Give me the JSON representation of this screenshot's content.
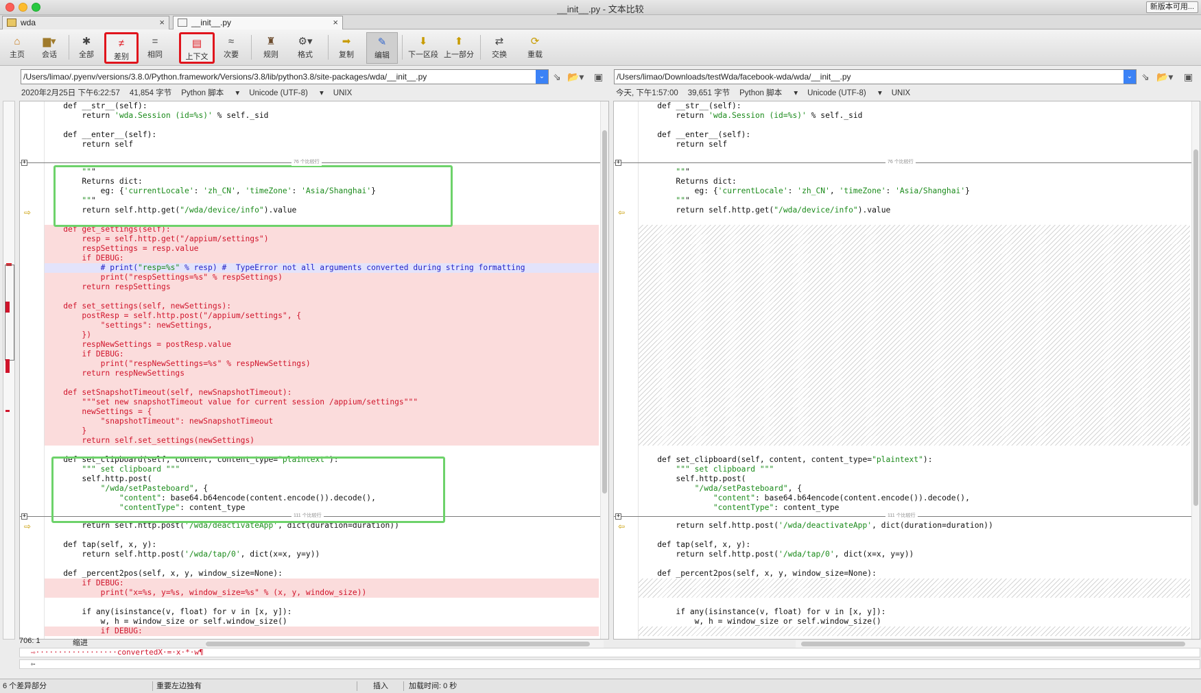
{
  "window": {
    "title": "__init__.py - 文本比较",
    "update_button": "新版本可用..."
  },
  "tabs": [
    {
      "label": "wda"
    },
    {
      "label": "__init__.py"
    }
  ],
  "toolbar": {
    "home": "主页",
    "session": "会话",
    "all": "全部",
    "diff": "差别",
    "same": "相同",
    "context": "上下文",
    "minor": "次要",
    "rules": "规则",
    "format": "格式",
    "copy": "复制",
    "edit": "编辑",
    "next_section": "下一区段",
    "prev_part": "上一部分",
    "swap": "交换",
    "reload": "重载"
  },
  "left": {
    "path": "/Users/limao/.pyenv/versions/3.8.0/Python.framework/Versions/3.8/lib/python3.8/site-packages/wda/__init__.py",
    "date": "2020年2月25日 下午6:22:57",
    "size": "41,854 字节",
    "lang": "Python 脚本",
    "encoding": "Unicode (UTF-8)",
    "eol": "UNIX"
  },
  "right": {
    "path": "/Users/limao/Downloads/testWda/facebook-wda/wda/__init__.py",
    "date": "今天, 下午1:57:00",
    "size": "39,651 字节",
    "lang": "Python 脚本",
    "encoding": "Unicode (UTF-8)",
    "eol": "UNIX"
  },
  "fold_labels": [
    "76 个比较行",
    "111 个比较行"
  ],
  "lines": [
    {
      "t": "s",
      "l": "    def __str__(self):",
      "r": "    def __str__(self):"
    },
    {
      "t": "s",
      "l": "        return 'wda.Session (id=%s)' % self._sid",
      "r": "        return 'wda.Session (id=%s)' % self._sid"
    },
    {
      "t": "s",
      "l": "",
      "r": ""
    },
    {
      "t": "s",
      "l": "    def __enter__(self):",
      "r": "    def __enter__(self):"
    },
    {
      "t": "s",
      "l": "        return self",
      "r": "        return self"
    },
    {
      "t": "s",
      "l": "",
      "r": ""
    },
    {
      "t": "fold",
      "f": 0
    },
    {
      "t": "s",
      "l": "        \"\"\"",
      "r": "        \"\"\""
    },
    {
      "t": "s",
      "l": "        Returns dict:",
      "r": "        Returns dict:"
    },
    {
      "t": "s",
      "l": "            eg: {'currentLocale': 'zh_CN', 'timeZone': 'Asia/Shanghai'}",
      "r": "            eg: {'currentLocale': 'zh_CN', 'timeZone': 'Asia/Shanghai'}"
    },
    {
      "t": "s",
      "l": "        \"\"\"",
      "r": "        \"\"\""
    },
    {
      "t": "s",
      "l": "        return self.http.get(\"/wda/device/info\").value",
      "r": "        return self.http.get(\"/wda/device/info\").value"
    },
    {
      "t": "s",
      "l": "",
      "r": ""
    },
    {
      "t": "d",
      "l": "    def get_settings(self):",
      "r": ""
    },
    {
      "t": "d",
      "l": "        resp = self.http.get(\"/appium/settings\")",
      "r": ""
    },
    {
      "t": "d",
      "l": "        respSettings = resp.value",
      "r": ""
    },
    {
      "t": "d",
      "l": "        if DEBUG:",
      "r": ""
    },
    {
      "t": "b",
      "l": "            # print(\"resp=%s\" % resp) #  TypeError not all arguments converted during string formatting",
      "r": ""
    },
    {
      "t": "d",
      "l": "            print(\"respSettings=%s\" % respSettings)",
      "r": ""
    },
    {
      "t": "d",
      "l": "        return respSettings",
      "r": ""
    },
    {
      "t": "d",
      "l": "",
      "r": ""
    },
    {
      "t": "d",
      "l": "    def set_settings(self, newSettings):",
      "r": ""
    },
    {
      "t": "d",
      "l": "        postResp = self.http.post(\"/appium/settings\", {",
      "r": ""
    },
    {
      "t": "d",
      "l": "            \"settings\": newSettings,",
      "r": ""
    },
    {
      "t": "d",
      "l": "        })",
      "r": ""
    },
    {
      "t": "d",
      "l": "        respNewSettings = postResp.value",
      "r": ""
    },
    {
      "t": "d",
      "l": "        if DEBUG:",
      "r": ""
    },
    {
      "t": "d",
      "l": "            print(\"respNewSettings=%s\" % respNewSettings)",
      "r": ""
    },
    {
      "t": "d",
      "l": "        return respNewSettings",
      "r": ""
    },
    {
      "t": "d",
      "l": "",
      "r": ""
    },
    {
      "t": "d",
      "l": "    def setSnapshotTimeout(self, newSnapshotTimeout):",
      "r": ""
    },
    {
      "t": "d",
      "l": "        \"\"\"set new snapshotTimeout value for current session /appium/settings\"\"\"",
      "r": ""
    },
    {
      "t": "d",
      "l": "        newSettings = {",
      "r": ""
    },
    {
      "t": "d",
      "l": "            \"snapshotTimeout\": newSnapshotTimeout",
      "r": ""
    },
    {
      "t": "d",
      "l": "        }",
      "r": ""
    },
    {
      "t": "d",
      "l": "        return self.set_settings(newSettings)",
      "r": ""
    },
    {
      "t": "s",
      "l": "",
      "r": ""
    },
    {
      "t": "s",
      "l": "    def set_clipboard(self, content, content_type=\"plaintext\"):",
      "r": "    def set_clipboard(self, content, content_type=\"plaintext\"):"
    },
    {
      "t": "s",
      "l": "        \"\"\" set clipboard \"\"\"",
      "r": "        \"\"\" set clipboard \"\"\""
    },
    {
      "t": "s",
      "l": "        self.http.post(",
      "r": "        self.http.post("
    },
    {
      "t": "s",
      "l": "            \"/wda/setPasteboard\", {",
      "r": "            \"/wda/setPasteboard\", {"
    },
    {
      "t": "s",
      "l": "                \"content\": base64.b64encode(content.encode()).decode(),",
      "r": "                \"content\": base64.b64encode(content.encode()).decode(),"
    },
    {
      "t": "s",
      "l": "                \"contentType\": content_type",
      "r": "                \"contentType\": content_type"
    },
    {
      "t": "fold",
      "f": 1
    },
    {
      "t": "s",
      "l": "        return self.http.post('/wda/deactivateApp', dict(duration=duration))",
      "r": "        return self.http.post('/wda/deactivateApp', dict(duration=duration))"
    },
    {
      "t": "s",
      "l": "",
      "r": ""
    },
    {
      "t": "s",
      "l": "    def tap(self, x, y):",
      "r": "    def tap(self, x, y):"
    },
    {
      "t": "s",
      "l": "        return self.http.post('/wda/tap/0', dict(x=x, y=y))",
      "r": "        return self.http.post('/wda/tap/0', dict(x=x, y=y))"
    },
    {
      "t": "s",
      "l": "",
      "r": ""
    },
    {
      "t": "s",
      "l": "    def _percent2pos(self, x, y, window_size=None):",
      "r": "    def _percent2pos(self, x, y, window_size=None):"
    },
    {
      "t": "d",
      "l": "        if DEBUG:",
      "r": ""
    },
    {
      "t": "d",
      "l": "            print(\"x=%s, y=%s, window_size=%s\" % (x, y, window_size))",
      "r": ""
    },
    {
      "t": "s",
      "l": "",
      "r": ""
    },
    {
      "t": "s",
      "l": "        if any(isinstance(v, float) for v in [x, y]):",
      "r": "        if any(isinstance(v, float) for v in [x, y]):"
    },
    {
      "t": "s",
      "l": "            w, h = window_size or self.window_size()",
      "r": "            w, h = window_size or self.window_size()"
    },
    {
      "t": "d",
      "l": "            if DEBUG:",
      "r": ""
    }
  ],
  "editor": {
    "position": "706: 1",
    "indent": "缩进"
  },
  "merge": {
    "line1": "⇨··················convertedX·=·x·*·w¶",
    "line2": "⇦"
  },
  "status": {
    "diffs": "6 个差异部分",
    "left_unique": "重要左边独有",
    "insert": "插入",
    "load_time": "加载时间: 0 秒"
  }
}
